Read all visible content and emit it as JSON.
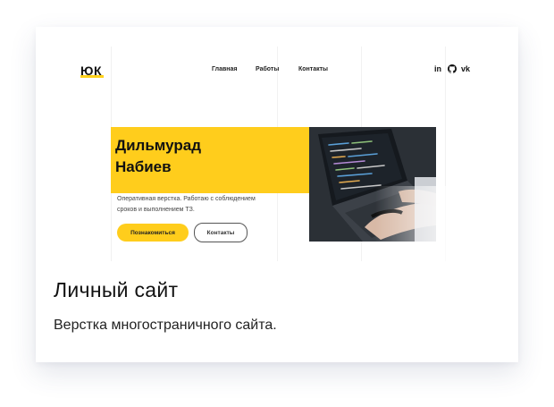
{
  "preview": {
    "logo": "ЮК",
    "nav": [
      "Главная",
      "Работы",
      "Контакты"
    ],
    "social": {
      "linkedin": "in",
      "github_icon": "github-icon",
      "vk": "vk"
    },
    "hero": {
      "name_line1": "Дильмурад",
      "name_line2": "Набиев",
      "description": "Оперативная верстка. Работаю с соблюдением сроков и выполнением ТЗ.",
      "primary_button": "Познакомиться",
      "secondary_button": "Контакты"
    },
    "accent_color": "#ffcd1c"
  },
  "card": {
    "title": "Личный сайт",
    "description": "Верстка многостраничного сайта."
  }
}
